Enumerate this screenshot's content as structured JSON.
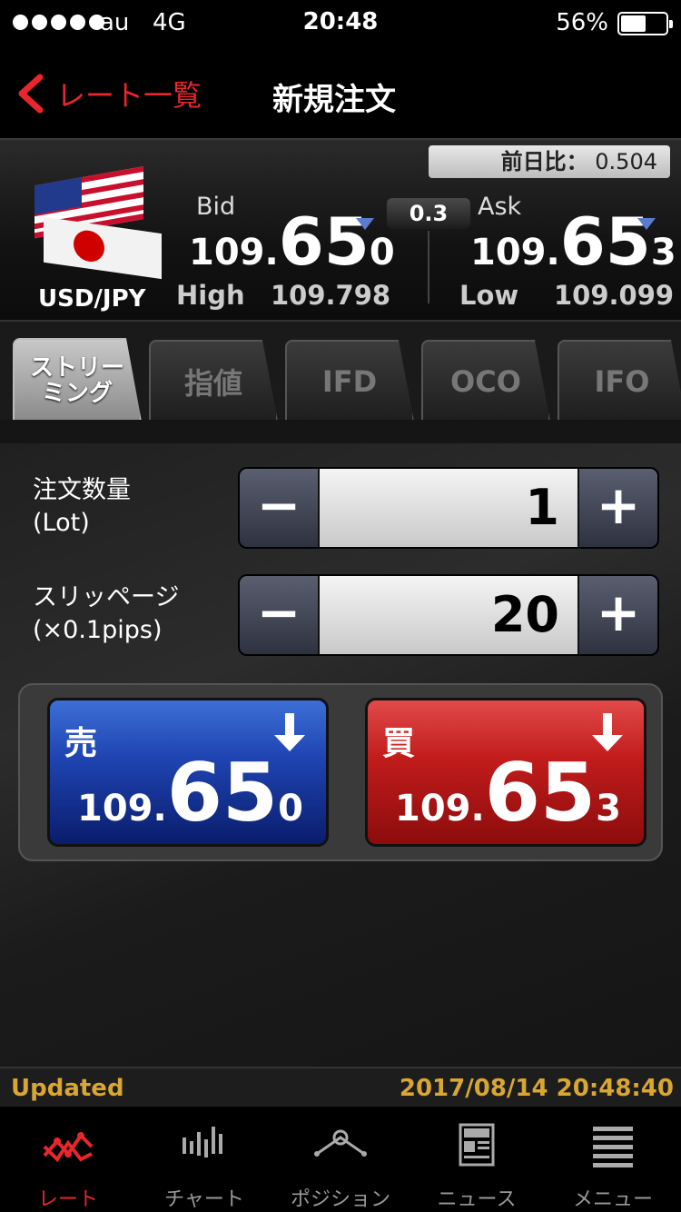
{
  "status_bar": {
    "carrier": "au",
    "network": "4G",
    "time": "20:48",
    "battery": "56%",
    "battery_level": 0.56
  },
  "nav": {
    "back_label": "レート一覧",
    "title": "新規注文"
  },
  "rate": {
    "prev_label": "前日比：",
    "prev_value": "0.504",
    "pair": "USD/JPY",
    "bid_label": "Bid",
    "bid": {
      "pre": "109.",
      "main": "65",
      "pip": "0"
    },
    "ask_label": "Ask",
    "ask": {
      "pre": "109.",
      "main": "65",
      "pip": "3"
    },
    "spread": "0.3",
    "high_label": "High",
    "high": "109.798",
    "low_label": "Low",
    "low": "109.099"
  },
  "tabs": [
    {
      "label": "ストリー\nミング",
      "active": true
    },
    {
      "label": "指値",
      "active": false
    },
    {
      "label": "IFD",
      "active": false
    },
    {
      "label": "OCO",
      "active": false
    },
    {
      "label": "IFO",
      "active": false
    }
  ],
  "order": {
    "qty_label_1": "注文数量",
    "qty_label_2": "(Lot)",
    "qty_value": "1",
    "slip_label_1": "スリッページ",
    "slip_label_2": "(×0.1pips)",
    "slip_value": "20",
    "minus": "−",
    "plus": "+"
  },
  "trade": {
    "sell_label": "売",
    "sell": {
      "pre": "109.",
      "main": "65",
      "pip": "0"
    },
    "buy_label": "買",
    "buy": {
      "pre": "109.",
      "main": "65",
      "pip": "3"
    }
  },
  "updated": {
    "label": "Updated",
    "timestamp": "2017/08/14 20:48:40"
  },
  "tabbar": [
    {
      "label": "レート",
      "icon": "rate-chart-icon",
      "active": true
    },
    {
      "label": "チャート",
      "icon": "candlestick-icon",
      "active": false
    },
    {
      "label": "ポジション",
      "icon": "position-icon",
      "active": false
    },
    {
      "label": "ニュース",
      "icon": "news-icon",
      "active": false
    },
    {
      "label": "メニュー",
      "icon": "menu-list-icon",
      "active": false
    }
  ],
  "colors": {
    "accent_red": "#e8262c",
    "updated_gold": "#d9a631",
    "sell_blue": "#1f44b2",
    "buy_red": "#c21c1c"
  }
}
